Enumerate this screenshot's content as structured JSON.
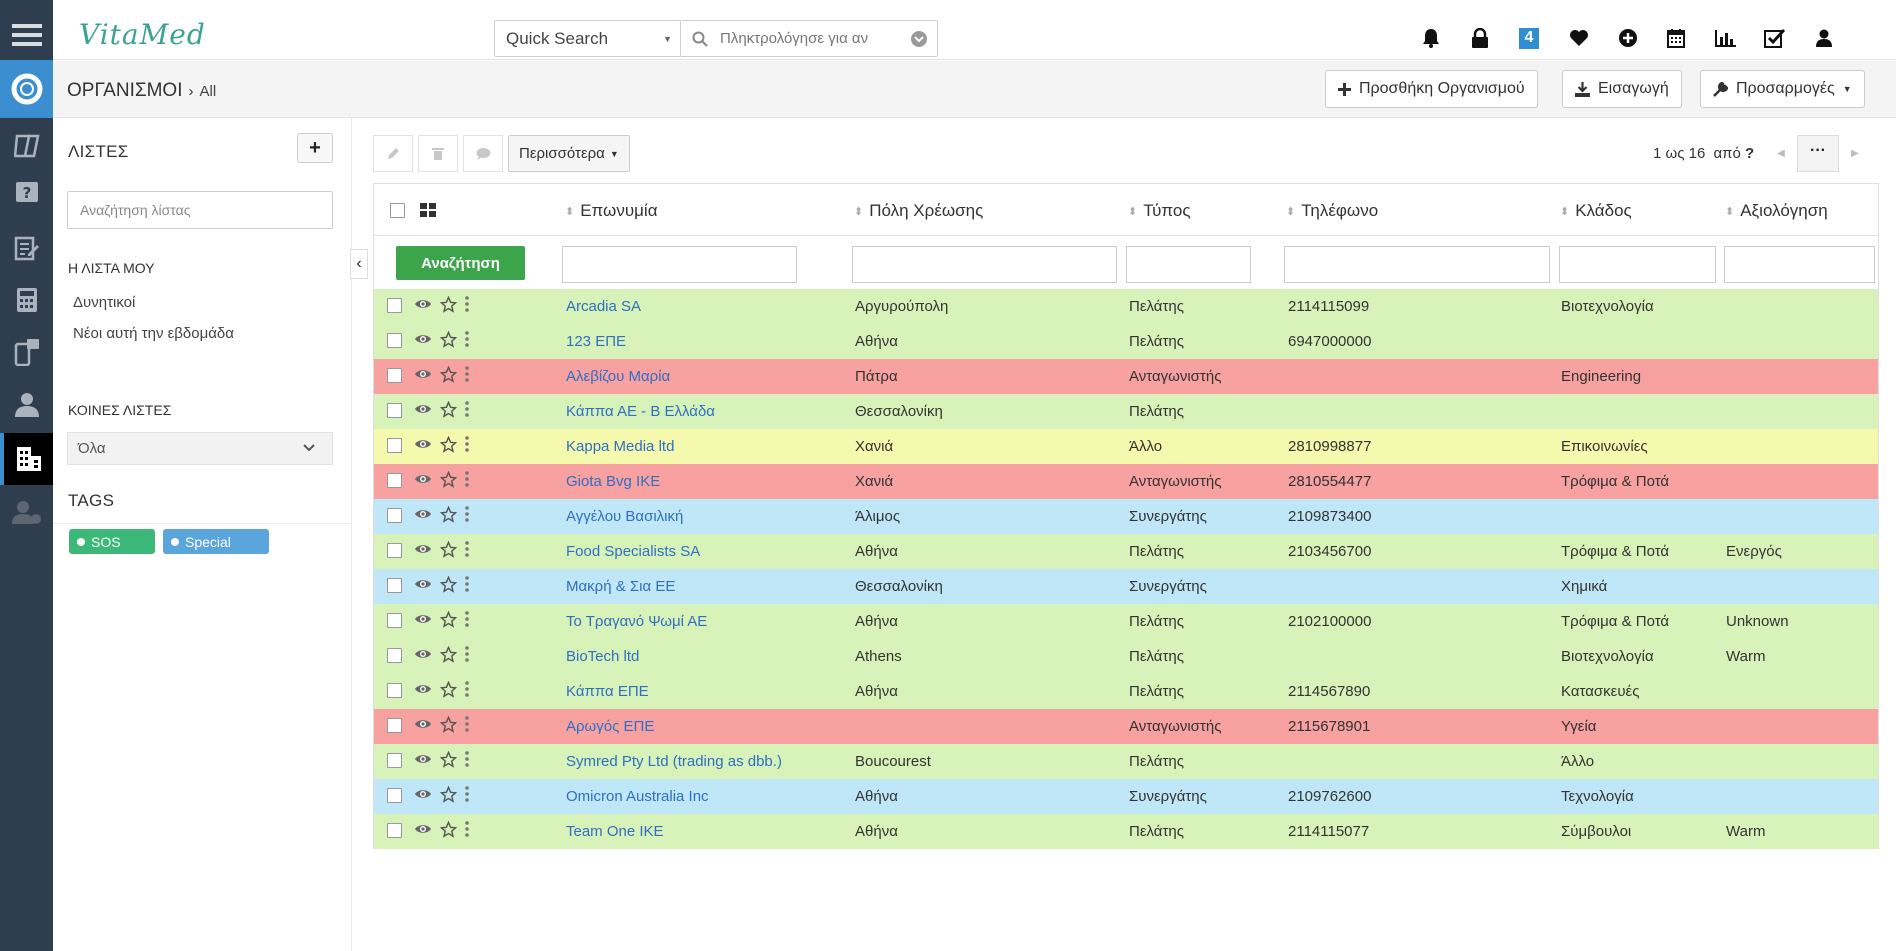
{
  "app": {
    "logo": "VitaMed"
  },
  "search": {
    "type_label": "Quick Search",
    "placeholder": "Πληκτρολόγησε για αν"
  },
  "topbar": {
    "badge_count": "4"
  },
  "header": {
    "title": "ΟΡΓΑΝΙΣΜΟΙ",
    "filter": "All",
    "add_label": "Προσθήκη Οργανισμού",
    "import_label": "Εισαγωγή",
    "customize_label": "Προσαρμογές"
  },
  "sidebar": {
    "lists_title": "ΛΙΣΤΕΣ",
    "search_placeholder": "Αναζήτηση λίστας",
    "my_list_title": "Η ΛΙΣΤΑ ΜΟΥ",
    "my_lists": [
      "Δυνητικοί",
      "Νέοι αυτή την εβδομάδα"
    ],
    "shared_title": "ΚΟΙΝΕΣ ΛΙΣΤΕΣ",
    "shared_selected": "Όλα",
    "tags_title": "TAGS",
    "tags": [
      {
        "label": "SOS",
        "color": "#3cb879"
      },
      {
        "label": "Special",
        "color": "#5aa5dc"
      }
    ]
  },
  "toolbar": {
    "more_label": "Περισσότερα",
    "pager_text": "1 ως 16",
    "pager_of": "από",
    "pager_total": "?"
  },
  "table": {
    "search_button": "Αναζήτηση",
    "columns": [
      "Επωνυμία",
      "Πόλη Χρέωσης",
      "Τύπος",
      "Τηλέφωνο",
      "Κλάδος",
      "Αξιολόγηση"
    ],
    "row_colors": {
      "green": "#d8f3b9",
      "red": "#f7a1a1",
      "yellow": "#f5f9ad",
      "blue": "#bfe7f7"
    },
    "rows": [
      {
        "name": "Arcadia SA",
        "city": "Αργυρούπολη",
        "type": "Πελάτης",
        "phone": "2114115099",
        "industry": "Βιοτεχνολογία",
        "rating": "",
        "color": "green"
      },
      {
        "name": "123 ΕΠΕ",
        "city": "Αθήνα",
        "type": "Πελάτης",
        "phone": "6947000000",
        "industry": "",
        "rating": "",
        "color": "green"
      },
      {
        "name": "Αλεβίζου Μαρία",
        "city": "Πάτρα",
        "type": "Ανταγωνιστής",
        "phone": "",
        "industry": "Engineering",
        "rating": "",
        "color": "red"
      },
      {
        "name": "Κάππα ΑΕ - Β Ελλάδα",
        "city": "Θεσσαλονίκη",
        "type": "Πελάτης",
        "phone": "",
        "industry": "",
        "rating": "",
        "color": "green"
      },
      {
        "name": "Kappa Media ltd",
        "city": "Χανιά",
        "type": "Άλλο",
        "phone": "2810998877",
        "industry": "Επικοινωνίες",
        "rating": "",
        "color": "yellow"
      },
      {
        "name": "Giota Bvg IKE",
        "city": "Χανιά",
        "type": "Ανταγωνιστής",
        "phone": "2810554477",
        "industry": "Τρόφιμα & Ποτά",
        "rating": "",
        "color": "red"
      },
      {
        "name": "Αγγέλου Βασιλική",
        "city": "Άλιμος",
        "type": "Συνεργάτης",
        "phone": "2109873400",
        "industry": "",
        "rating": "",
        "color": "blue"
      },
      {
        "name": "Food Specialists SA",
        "city": "Αθήνα",
        "type": "Πελάτης",
        "phone": "2103456700",
        "industry": "Τρόφιμα & Ποτά",
        "rating": "Ενεργός",
        "color": "green"
      },
      {
        "name": "Μακρή & Σια ΕΕ",
        "city": "Θεσσαλονίκη",
        "type": "Συνεργάτης",
        "phone": "",
        "industry": "Χημικά",
        "rating": "",
        "color": "blue"
      },
      {
        "name": "Το Τραγανό Ψωμί ΑΕ",
        "city": "Αθήνα",
        "type": "Πελάτης",
        "phone": "2102100000",
        "industry": "Τρόφιμα & Ποτά",
        "rating": "Unknown",
        "color": "green"
      },
      {
        "name": "BioTech ltd",
        "city": "Athens",
        "type": "Πελάτης",
        "phone": "",
        "industry": "Βιοτεχνολογία",
        "rating": "Warm",
        "color": "green"
      },
      {
        "name": "Κάππα ΕΠΕ",
        "city": "Αθήνα",
        "type": "Πελάτης",
        "phone": "2114567890",
        "industry": "Κατασκευές",
        "rating": "",
        "color": "green"
      },
      {
        "name": "Αρωγός ΕΠΕ",
        "city": "",
        "type": "Ανταγωνιστής",
        "phone": "2115678901",
        "industry": "Υγεία",
        "rating": "",
        "color": "red"
      },
      {
        "name": "Symred Pty Ltd (trading as dbb.)",
        "city": "Boucourest",
        "type": "Πελάτης",
        "phone": "",
        "industry": "Άλλο",
        "rating": "",
        "color": "green"
      },
      {
        "name": "Omicron Australia Inc",
        "city": "Αθήνα",
        "type": "Συνεργάτης",
        "phone": "2109762600",
        "industry": "Τεχνολογία",
        "rating": "",
        "color": "blue"
      },
      {
        "name": "Team One IKE",
        "city": "Αθήνα",
        "type": "Πελάτης",
        "phone": "2114115077",
        "industry": "Σύμβουλοι",
        "rating": "Warm",
        "color": "green"
      }
    ]
  }
}
